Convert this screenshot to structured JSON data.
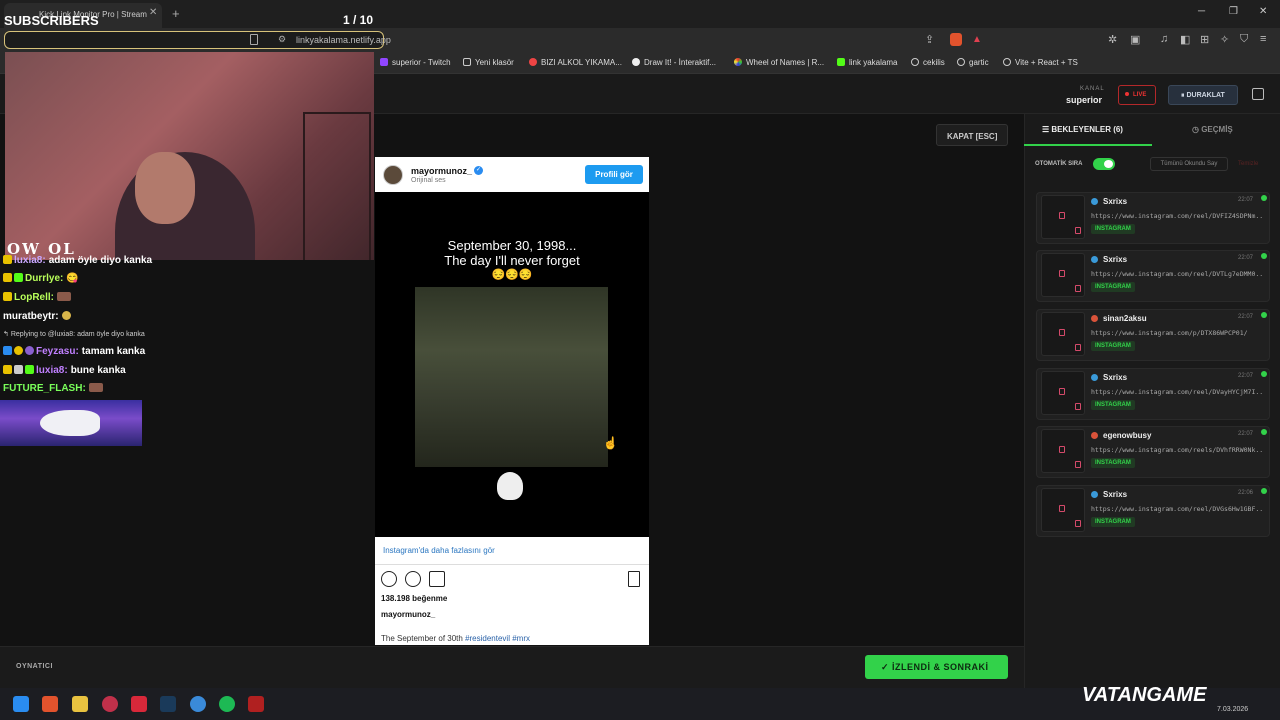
{
  "browser": {
    "tab_title": "Kick Link Monitor Pro | Stream",
    "url": "linkyakalama.netlify.app",
    "bookmarks": [
      "superior - Twitch",
      "Yeni klasör",
      "BIZI ALKOL YIKAMA...",
      "Draw It! - İnteraktif...",
      "Wheel of Names | R...",
      "link yakalama",
      "cekilis",
      "gartic",
      "Vite + React + TS"
    ]
  },
  "header": {
    "kanal_label": "KANAL",
    "kanal_name": "superior",
    "live_label": "LIVE",
    "pause_label": "DURAKLAT"
  },
  "main": {
    "close_label": "KAPAT [ESC]",
    "player_label": "OYNATICI",
    "next_label": "İZLENDİ & SONRAKİ"
  },
  "instagram": {
    "username": "mayormunoz_",
    "subtitle": "Orijinal ses",
    "profile_btn": "Profili gör",
    "caption_line1": "September 30, 1998...",
    "caption_line2": "The day I'll never forget",
    "caption_emoji": "😔😔😔",
    "more_link": "Instagram'da daha fazlasını gör",
    "likes": "138.198 beğenme",
    "username2": "mayormunoz_",
    "desc_text": "The September of 30th",
    "tag1": "#residentevil",
    "tag2": "#mrx"
  },
  "panel": {
    "tab_wait": "BEKLEYENLER (6)",
    "tab_history": "GEÇMİŞ",
    "auto_label": "OTOMATİK SIRA",
    "mark_all": "Tümünü Okundu Say",
    "clear_all": "Temizle",
    "badge": "INSTAGRAM",
    "queue": [
      {
        "user": "Sxrixs",
        "time": "22:07",
        "link": "https://www.instagram.com/reel/DVFIZ4SDPNm...",
        "color": "#3a9ad9"
      },
      {
        "user": "Sxrixs",
        "time": "22:07",
        "link": "https://www.instagram.com/reel/DVTLg7eDMM0...",
        "color": "#3a9ad9"
      },
      {
        "user": "sinan2aksu",
        "time": "22:07",
        "link": "https://www.instagram.com/p/DTX86WPCP01/",
        "color": "#d9533a"
      },
      {
        "user": "Sxrixs",
        "time": "22:07",
        "link": "https://www.instagram.com/reel/DVayHYCjM7I...",
        "color": "#3a9ad9"
      },
      {
        "user": "egenowbusy",
        "time": "22:07",
        "link": "https://www.instagram.com/reels/DVhfRRW0Nk...",
        "color": "#d9533a"
      },
      {
        "user": "Sxrixs",
        "time": "22:06",
        "link": "https://www.instagram.com/reel/DVGs6Hw1GBF...",
        "color": "#3a9ad9"
      }
    ]
  },
  "overlay": {
    "subscribers_label": "SUBSCRIBERS",
    "subscribers_count": "1 / 10",
    "owl_text": "OW OL",
    "chat": [
      {
        "name": "luxia8:",
        "text": "adam öyle diyo kanka",
        "color": "#c9a7ff"
      },
      {
        "name": "Durrlye:",
        "text": "😋",
        "color": "#b9ff5a"
      },
      {
        "name": "LopRell:",
        "text": "",
        "color": "#b9ff5a"
      },
      {
        "name": "muratbeytr:",
        "text": "",
        "color": "#ffffff"
      },
      {
        "name": "Feyzasu:",
        "text": "tamam kanka",
        "color": "#c080ff"
      },
      {
        "name": "luxia8:",
        "text": "bune kanka",
        "color": "#c080ff"
      },
      {
        "name": "FUTURE_FLASH:",
        "text": "",
        "color": "#7aff5a"
      }
    ],
    "reply_text": "Replying to @luxia8: adam öyle diyo kanka"
  },
  "taskbar": {
    "watermark": "VATANGAME",
    "version": "7.03.2026"
  }
}
